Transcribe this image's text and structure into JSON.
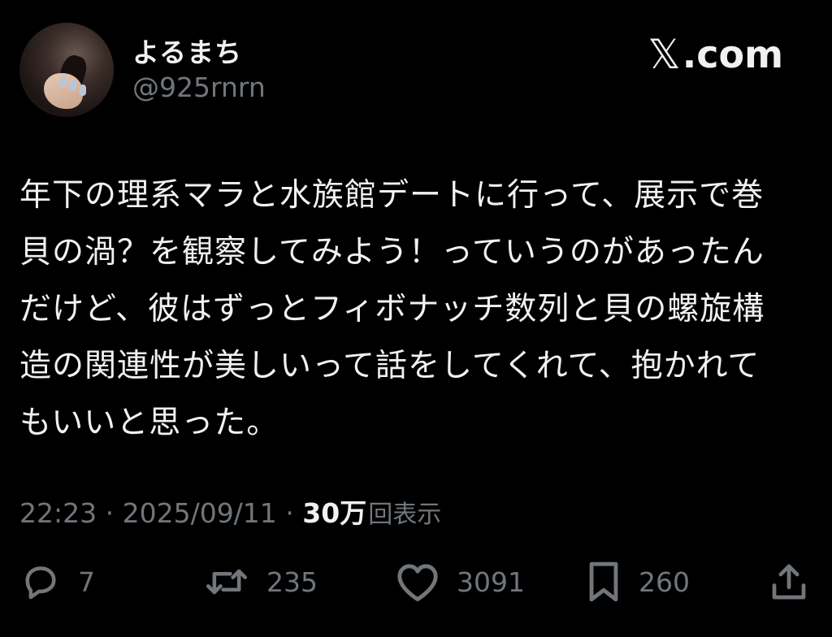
{
  "author": {
    "display_name": "よるまち",
    "handle": "@925rnrn"
  },
  "site_logo": {
    "mark": "𝕏",
    "text": ".com"
  },
  "tweet": {
    "text": "年下の理系マラと水族館デートに行って、展示で巻\n貝の渦？を観察してみよう！っていうのがあったん\nだけど、彼はずっとフィボナッチ数列と貝の螺旋構\n造の関連性が美しいって話をしてくれて、抱かれて\nもいいと思った。"
  },
  "meta": {
    "time": "22:23",
    "separator1": " · ",
    "date": "2025/09/11",
    "separator2": " · ",
    "views_count": "30万",
    "views_label": "回表示"
  },
  "actions": {
    "reply": {
      "icon": "reply-icon",
      "count": "7"
    },
    "repost": {
      "icon": "repost-icon",
      "count": "235"
    },
    "like": {
      "icon": "heart-icon",
      "count": "3091"
    },
    "bookmark": {
      "icon": "bookmark-icon",
      "count": "260"
    },
    "share": {
      "icon": "share-icon"
    }
  },
  "colors": {
    "background": "#000000",
    "primary_text": "#f1f1f1",
    "secondary_text": "#71767b"
  }
}
